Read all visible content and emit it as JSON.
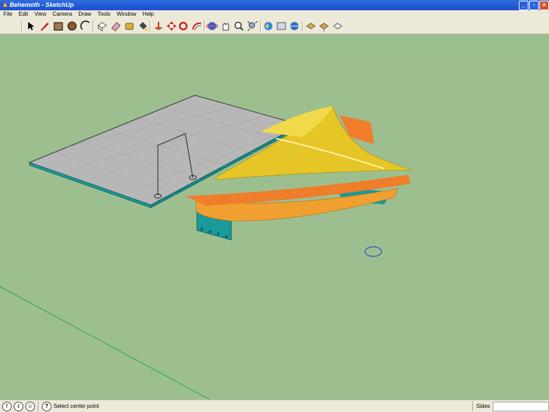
{
  "window": {
    "title": "Behemoth - SketchUp"
  },
  "menu": [
    "File",
    "Edit",
    "View",
    "Camera",
    "Draw",
    "Tools",
    "Window",
    "Help"
  ],
  "toolbar": {
    "tools": [
      "select-tool-icon",
      "pencil-tool-icon",
      "rectangle-tool-icon",
      "circle-tool-icon",
      "arc-tool-icon",
      "make-component-icon",
      "eraser-tool-icon",
      "tape-measure-icon",
      "paint-bucket-icon",
      "push-pull-icon",
      "move-tool-icon",
      "rotate-tool-icon",
      "offset-tool-icon",
      "orbit-tool-icon",
      "pan-tool-icon",
      "zoom-tool-icon",
      "zoom-extents-icon",
      "previous-view-icon",
      "next-view-icon",
      "get-models-icon",
      "share-model-icon",
      "get-component-icon",
      "share-component-icon"
    ]
  },
  "status": {
    "prompt": "Select center point",
    "vcb_label": "Sides",
    "vcb_value": ""
  },
  "colors": {
    "viewport_bg": "#9dbf8f",
    "axis_green": "#2aa54a",
    "model_yellow": "#e6c526",
    "model_orange": "#f07d2a",
    "model_teal": "#1a9a9a",
    "plate_gray": "#b7b7b7"
  }
}
